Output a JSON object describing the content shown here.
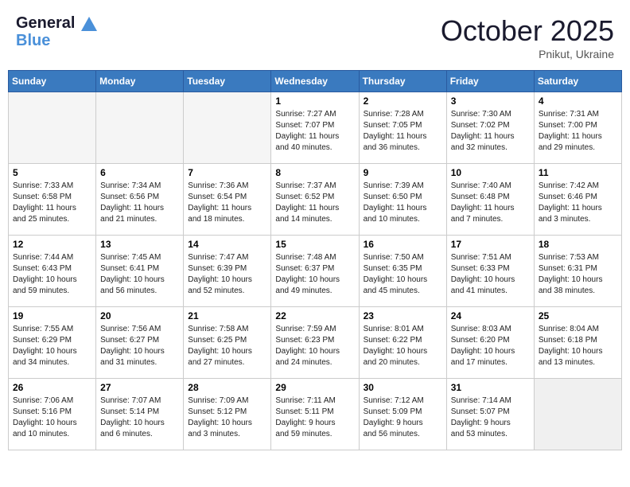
{
  "header": {
    "logo_line1": "General",
    "logo_line2": "Blue",
    "month": "October 2025",
    "location": "Pnikut, Ukraine"
  },
  "weekdays": [
    "Sunday",
    "Monday",
    "Tuesday",
    "Wednesday",
    "Thursday",
    "Friday",
    "Saturday"
  ],
  "weeks": [
    [
      {
        "day": "",
        "info": ""
      },
      {
        "day": "",
        "info": ""
      },
      {
        "day": "",
        "info": ""
      },
      {
        "day": "1",
        "info": "Sunrise: 7:27 AM\nSunset: 7:07 PM\nDaylight: 11 hours\nand 40 minutes."
      },
      {
        "day": "2",
        "info": "Sunrise: 7:28 AM\nSunset: 7:05 PM\nDaylight: 11 hours\nand 36 minutes."
      },
      {
        "day": "3",
        "info": "Sunrise: 7:30 AM\nSunset: 7:02 PM\nDaylight: 11 hours\nand 32 minutes."
      },
      {
        "day": "4",
        "info": "Sunrise: 7:31 AM\nSunset: 7:00 PM\nDaylight: 11 hours\nand 29 minutes."
      }
    ],
    [
      {
        "day": "5",
        "info": "Sunrise: 7:33 AM\nSunset: 6:58 PM\nDaylight: 11 hours\nand 25 minutes."
      },
      {
        "day": "6",
        "info": "Sunrise: 7:34 AM\nSunset: 6:56 PM\nDaylight: 11 hours\nand 21 minutes."
      },
      {
        "day": "7",
        "info": "Sunrise: 7:36 AM\nSunset: 6:54 PM\nDaylight: 11 hours\nand 18 minutes."
      },
      {
        "day": "8",
        "info": "Sunrise: 7:37 AM\nSunset: 6:52 PM\nDaylight: 11 hours\nand 14 minutes."
      },
      {
        "day": "9",
        "info": "Sunrise: 7:39 AM\nSunset: 6:50 PM\nDaylight: 11 hours\nand 10 minutes."
      },
      {
        "day": "10",
        "info": "Sunrise: 7:40 AM\nSunset: 6:48 PM\nDaylight: 11 hours\nand 7 minutes."
      },
      {
        "day": "11",
        "info": "Sunrise: 7:42 AM\nSunset: 6:46 PM\nDaylight: 11 hours\nand 3 minutes."
      }
    ],
    [
      {
        "day": "12",
        "info": "Sunrise: 7:44 AM\nSunset: 6:43 PM\nDaylight: 10 hours\nand 59 minutes."
      },
      {
        "day": "13",
        "info": "Sunrise: 7:45 AM\nSunset: 6:41 PM\nDaylight: 10 hours\nand 56 minutes."
      },
      {
        "day": "14",
        "info": "Sunrise: 7:47 AM\nSunset: 6:39 PM\nDaylight: 10 hours\nand 52 minutes."
      },
      {
        "day": "15",
        "info": "Sunrise: 7:48 AM\nSunset: 6:37 PM\nDaylight: 10 hours\nand 49 minutes."
      },
      {
        "day": "16",
        "info": "Sunrise: 7:50 AM\nSunset: 6:35 PM\nDaylight: 10 hours\nand 45 minutes."
      },
      {
        "day": "17",
        "info": "Sunrise: 7:51 AM\nSunset: 6:33 PM\nDaylight: 10 hours\nand 41 minutes."
      },
      {
        "day": "18",
        "info": "Sunrise: 7:53 AM\nSunset: 6:31 PM\nDaylight: 10 hours\nand 38 minutes."
      }
    ],
    [
      {
        "day": "19",
        "info": "Sunrise: 7:55 AM\nSunset: 6:29 PM\nDaylight: 10 hours\nand 34 minutes."
      },
      {
        "day": "20",
        "info": "Sunrise: 7:56 AM\nSunset: 6:27 PM\nDaylight: 10 hours\nand 31 minutes."
      },
      {
        "day": "21",
        "info": "Sunrise: 7:58 AM\nSunset: 6:25 PM\nDaylight: 10 hours\nand 27 minutes."
      },
      {
        "day": "22",
        "info": "Sunrise: 7:59 AM\nSunset: 6:23 PM\nDaylight: 10 hours\nand 24 minutes."
      },
      {
        "day": "23",
        "info": "Sunrise: 8:01 AM\nSunset: 6:22 PM\nDaylight: 10 hours\nand 20 minutes."
      },
      {
        "day": "24",
        "info": "Sunrise: 8:03 AM\nSunset: 6:20 PM\nDaylight: 10 hours\nand 17 minutes."
      },
      {
        "day": "25",
        "info": "Sunrise: 8:04 AM\nSunset: 6:18 PM\nDaylight: 10 hours\nand 13 minutes."
      }
    ],
    [
      {
        "day": "26",
        "info": "Sunrise: 7:06 AM\nSunset: 5:16 PM\nDaylight: 10 hours\nand 10 minutes."
      },
      {
        "day": "27",
        "info": "Sunrise: 7:07 AM\nSunset: 5:14 PM\nDaylight: 10 hours\nand 6 minutes."
      },
      {
        "day": "28",
        "info": "Sunrise: 7:09 AM\nSunset: 5:12 PM\nDaylight: 10 hours\nand 3 minutes."
      },
      {
        "day": "29",
        "info": "Sunrise: 7:11 AM\nSunset: 5:11 PM\nDaylight: 9 hours\nand 59 minutes."
      },
      {
        "day": "30",
        "info": "Sunrise: 7:12 AM\nSunset: 5:09 PM\nDaylight: 9 hours\nand 56 minutes."
      },
      {
        "day": "31",
        "info": "Sunrise: 7:14 AM\nSunset: 5:07 PM\nDaylight: 9 hours\nand 53 minutes."
      },
      {
        "day": "",
        "info": ""
      }
    ]
  ]
}
